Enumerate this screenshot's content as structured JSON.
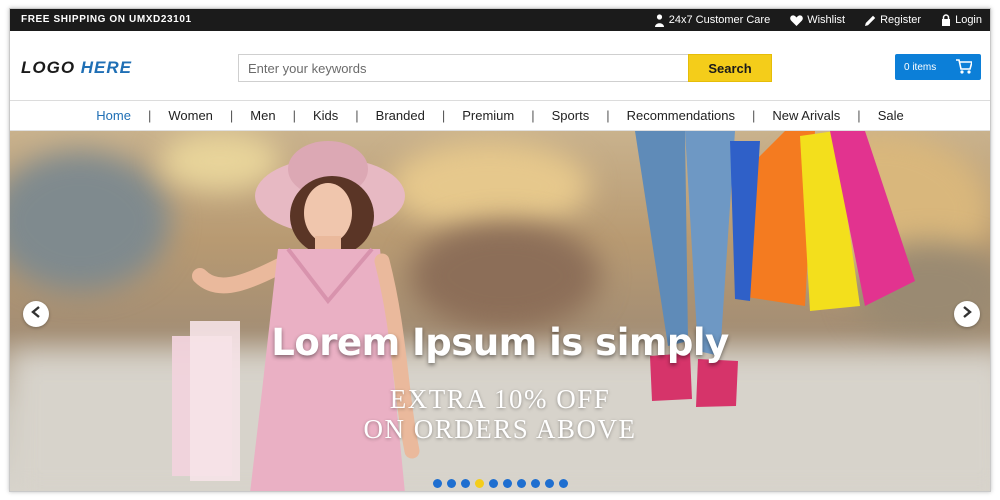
{
  "topbar": {
    "shipping": "FREE SHIPPING ON UMXD23101",
    "customer_care": "24x7 Customer Care",
    "wishlist": "Wishlist",
    "register": "Register",
    "login": "Login"
  },
  "header": {
    "logo_part1": "LOGO ",
    "logo_part2": "HERE",
    "search_placeholder": "Enter your keywords",
    "search_button": "Search",
    "cart_label": "0 items"
  },
  "nav": {
    "items": [
      {
        "label": "Home"
      },
      {
        "label": "Women"
      },
      {
        "label": "Men"
      },
      {
        "label": "Kids"
      },
      {
        "label": "Branded"
      },
      {
        "label": "Premium"
      },
      {
        "label": "Sports"
      },
      {
        "label": "Recommendations"
      },
      {
        "label": "New Arivals"
      },
      {
        "label": "Sale"
      }
    ],
    "separator": "|"
  },
  "hero": {
    "headline": "Lorem Ipsum is simply",
    "line1": "EXTRA 10% OFF",
    "line2": "ON ORDERS ABOVE",
    "slide_count": 10,
    "active_slide": 3
  },
  "colors": {
    "accent_blue": "#1f6fb5",
    "search_yellow": "#f4cd1a",
    "cart_blue": "#0c7fd8",
    "topbar_dark": "#1b1b1b"
  }
}
